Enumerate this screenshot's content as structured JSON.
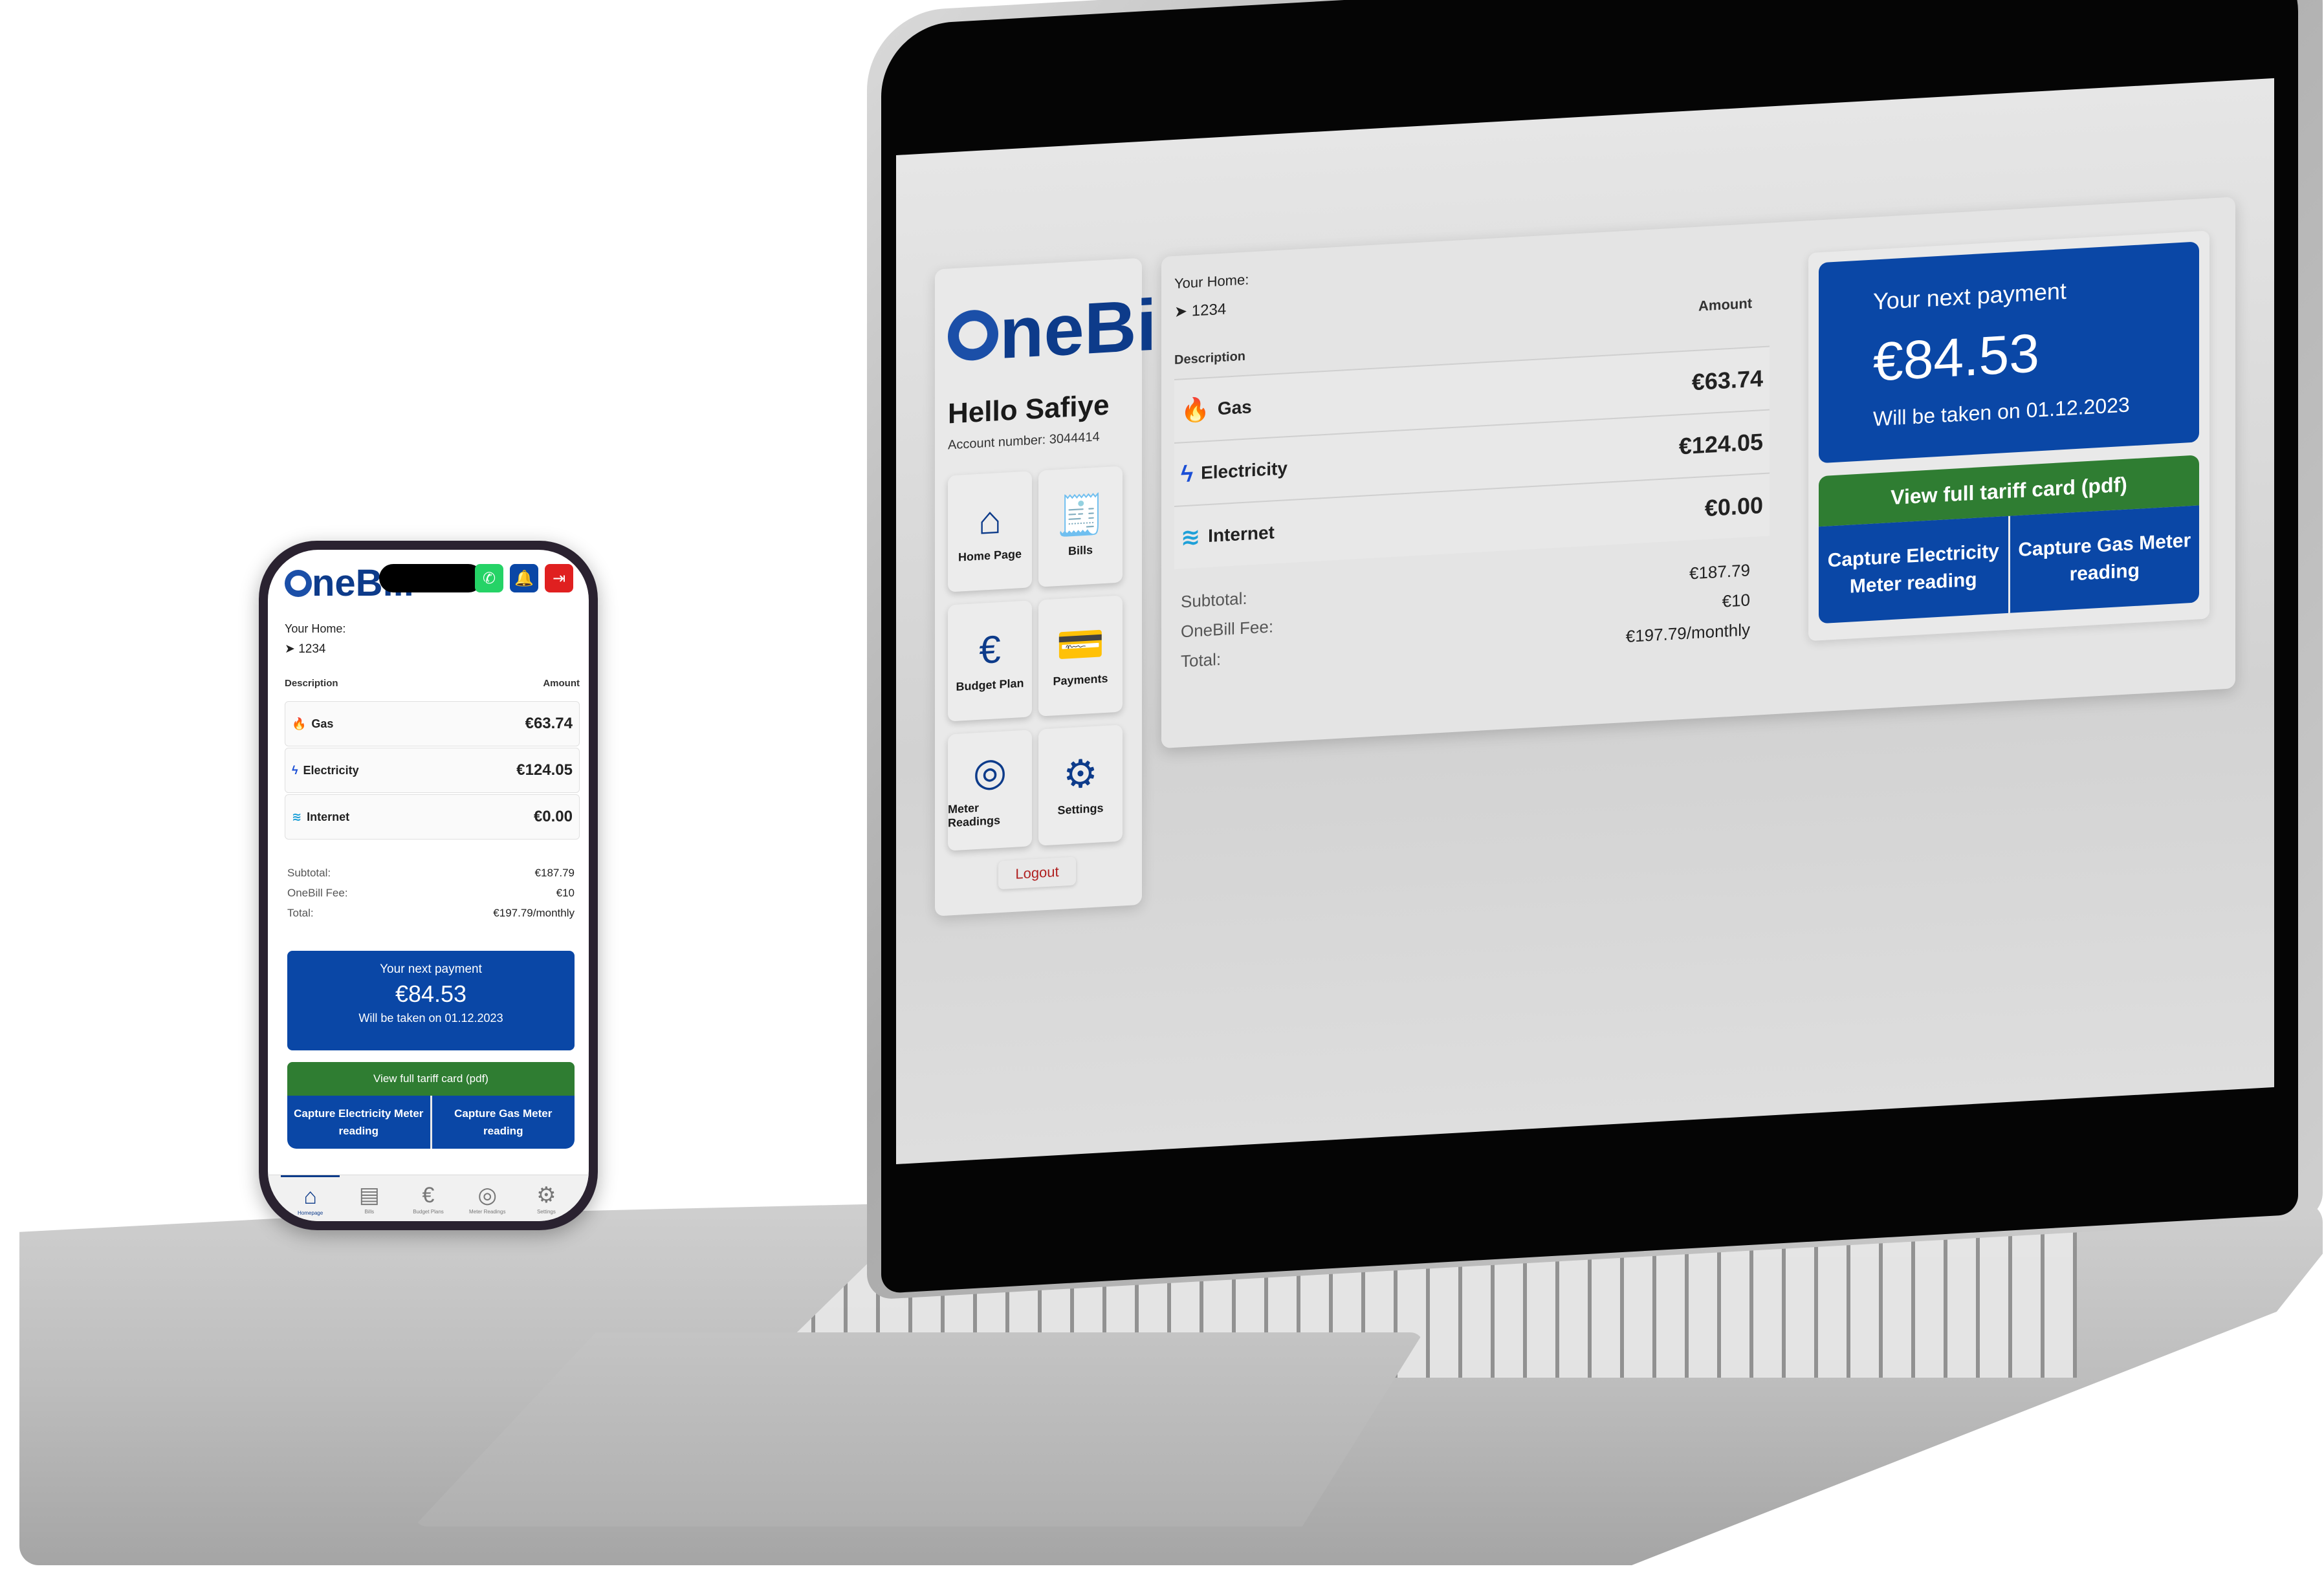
{
  "brand": {
    "logo_text": "neBill",
    "colors": {
      "primary": "#0a47a6",
      "tariff_green": "#2f7d32",
      "logout_red": "#b02020"
    }
  },
  "desktop": {
    "hello": "Hello Safiye",
    "account_number": "Account number: 3044414",
    "tiles": [
      {
        "label": "Home Page",
        "icon": "home-icon"
      },
      {
        "label": "Bills",
        "icon": "bill-icon"
      },
      {
        "label": "Budget Plan",
        "icon": "euro-icon"
      },
      {
        "label": "Payments",
        "icon": "card-icon"
      },
      {
        "label": "Meter Readings",
        "icon": "meter-icon"
      },
      {
        "label": "Settings",
        "icon": "gear-icon"
      }
    ],
    "logout_label": "Logout"
  },
  "home": {
    "your_home_label": "Your Home:",
    "address": "1234"
  },
  "table": {
    "description_header": "Description",
    "amount_header": "Amount",
    "rows": [
      {
        "name": "Gas",
        "amount": "€63.74",
        "icon": "flame-icon",
        "icon_color": "#d8332b"
      },
      {
        "name": "Electricity",
        "amount": "€124.05",
        "icon": "bolt-icon",
        "icon_color": "#1b4fd6"
      },
      {
        "name": "Internet",
        "amount": "€0.00",
        "icon": "wifi-icon",
        "icon_color": "#1ea0d8"
      }
    ]
  },
  "totals": {
    "subtotal_label": "Subtotal:",
    "subtotal_value": "€187.79",
    "fee_label": "OneBill Fee:",
    "fee_value": "€10",
    "total_label": "Total:",
    "total_value": "€197.79/monthly"
  },
  "payment": {
    "title": "Your next payment",
    "amount": "€84.53",
    "note": "Will be taken on 01.12.2023",
    "tariff_button": "View full tariff card (pdf)",
    "capture_electricity": "Capture Electricity Meter reading",
    "capture_gas": "Capture Gas Meter reading"
  },
  "mobile_nav": [
    {
      "label": "Homepage",
      "icon": "home-icon"
    },
    {
      "label": "Bills",
      "icon": "bill-icon"
    },
    {
      "label": "Budget Plans",
      "icon": "euro-icon"
    },
    {
      "label": "Meter Readings",
      "icon": "meter-icon"
    },
    {
      "label": "Settings",
      "icon": "gear-icon"
    }
  ]
}
